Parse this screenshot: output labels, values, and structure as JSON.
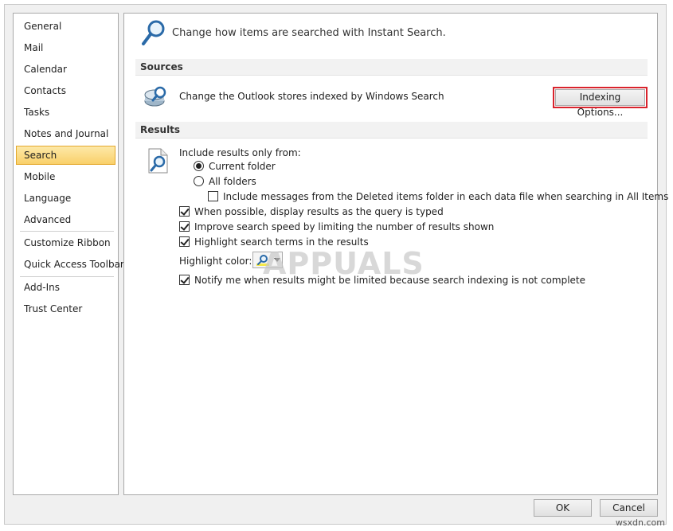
{
  "sidebar": {
    "items": [
      {
        "label": "General"
      },
      {
        "label": "Mail"
      },
      {
        "label": "Calendar"
      },
      {
        "label": "Contacts"
      },
      {
        "label": "Tasks"
      },
      {
        "label": "Notes and Journal"
      },
      {
        "label": "Search",
        "selected": true
      },
      {
        "label": "Mobile"
      },
      {
        "label": "Language"
      },
      {
        "label": "Advanced"
      },
      {
        "label": "Customize Ribbon"
      },
      {
        "label": "Quick Access Toolbar"
      },
      {
        "label": "Add-Ins"
      },
      {
        "label": "Trust Center"
      }
    ]
  },
  "header": {
    "icon": "magnifier-icon",
    "text": "Change how items are searched with Instant Search."
  },
  "sources": {
    "title": "Sources",
    "icon": "indexed-store-icon",
    "description": "Change the Outlook stores indexed by Windows Search",
    "button_label": "Indexing Options..."
  },
  "results": {
    "title": "Results",
    "icon": "search-document-icon",
    "include_label": "Include results only from:",
    "radio_current": {
      "label": "Current folder",
      "checked": true
    },
    "radio_all": {
      "label": "All folders",
      "checked": false
    },
    "deleted_items": {
      "label": "Include messages from the Deleted items folder in each data file when searching in All Items",
      "checked": false
    },
    "display_as_typed": {
      "label": "When possible, display results as the query is typed",
      "checked": true
    },
    "improve_speed": {
      "label": "Improve search speed by limiting the number of results shown",
      "checked": true
    },
    "highlight_terms": {
      "label": "Highlight search terms in the results",
      "checked": true
    },
    "highlight_color_label": "Highlight color:",
    "highlight_color": "#f5e94a",
    "notify": {
      "label": "Notify me when results might be limited because search indexing is not complete",
      "checked": true
    }
  },
  "footer": {
    "ok_label": "OK",
    "cancel_label": "Cancel"
  },
  "watermark": {
    "text": "APPUALS",
    "site": "wsxdn.com"
  }
}
